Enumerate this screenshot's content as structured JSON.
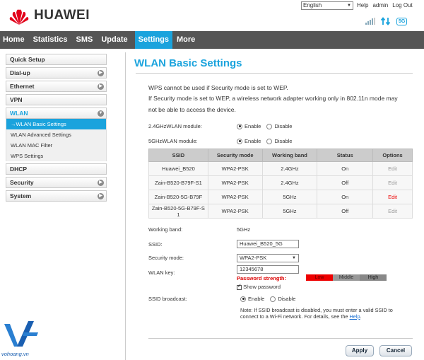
{
  "brand": {
    "name": "HUAWEI",
    "logo_color": "#e2001a"
  },
  "top": {
    "language": "English",
    "help": "Help",
    "admin": "admin",
    "logout": "Log Out",
    "net_badge": "5G"
  },
  "nav": {
    "items": [
      "Home",
      "Statistics",
      "SMS",
      "Update",
      "Settings",
      "More"
    ],
    "active": 4,
    "accent": "#1aa3dd"
  },
  "sidebar": {
    "quick_setup": "Quick Setup",
    "dialup": "Dial-up",
    "ethernet": "Ethernet",
    "vpn": "VPN",
    "wlan": "WLAN",
    "wlan_sub": [
      "WLAN Basic Settings",
      "WLAN Advanced Settings",
      "WLAN MAC Filter",
      "WPS Settings"
    ],
    "wlan_active_prefix": "→",
    "dhcp": "DHCP",
    "security": "Security",
    "system": "System"
  },
  "page": {
    "title": "WLAN Basic Settings",
    "warning1": "WPS cannot be used if Security mode is set to WEP.",
    "warning2": "If Security mode is set to WEP, a wireless network adapter working only in 802.11n mode may",
    "warning3": "not be able to access the device.",
    "module24_label": "2.4GHzWLAN module:",
    "module5_label": "5GHzWLAN module:",
    "enable": "Enable",
    "disable": "Disable",
    "table": {
      "headers": [
        "SSID",
        "Security mode",
        "Working band",
        "Status",
        "Options"
      ],
      "rows": [
        {
          "ssid": "Huawei_B520",
          "mode": "WPA2-PSK",
          "band": "2.4GHz",
          "status": "On",
          "option": "Edit",
          "highlight": false
        },
        {
          "ssid": "Zain-B520-B79F-S1",
          "mode": "WPA2-PSK",
          "band": "2.4GHz",
          "status": "Off",
          "option": "Edit",
          "highlight": false
        },
        {
          "ssid": "Zain-B520-5G-B79F",
          "mode": "WPA2-PSK",
          "band": "5GHz",
          "status": "On",
          "option": "Edit",
          "highlight": true
        },
        {
          "ssid": "Zain-B520-5G-B79F-S 1",
          "mode": "WPA2-PSK",
          "band": "5GHz",
          "status": "Off",
          "option": "Edit",
          "highlight": false
        }
      ]
    },
    "working_band_label": "Working band:",
    "working_band_value": "5GHz",
    "ssid_label": "SSID:",
    "ssid_value": "Huawei_B520_5G",
    "security_label": "Security mode:",
    "security_value": "WPA2-PSK",
    "key_label": "WLAN key:",
    "key_value": "12345678",
    "strength_label": "Password strength:",
    "strength_levels": [
      "Low",
      "Middle",
      "High"
    ],
    "show_password": "Show password",
    "broadcast_label": "SSID broadcast:",
    "note1": "Note: If SSID broadcast is disabled, you must enter a valid SSID to",
    "note2": "connect to a Wi-Fi network. For details, see the ",
    "note_link": "Help",
    "note_end": ".",
    "apply": "Apply",
    "cancel": "Cancel"
  },
  "watermark": "vohoang.vn"
}
